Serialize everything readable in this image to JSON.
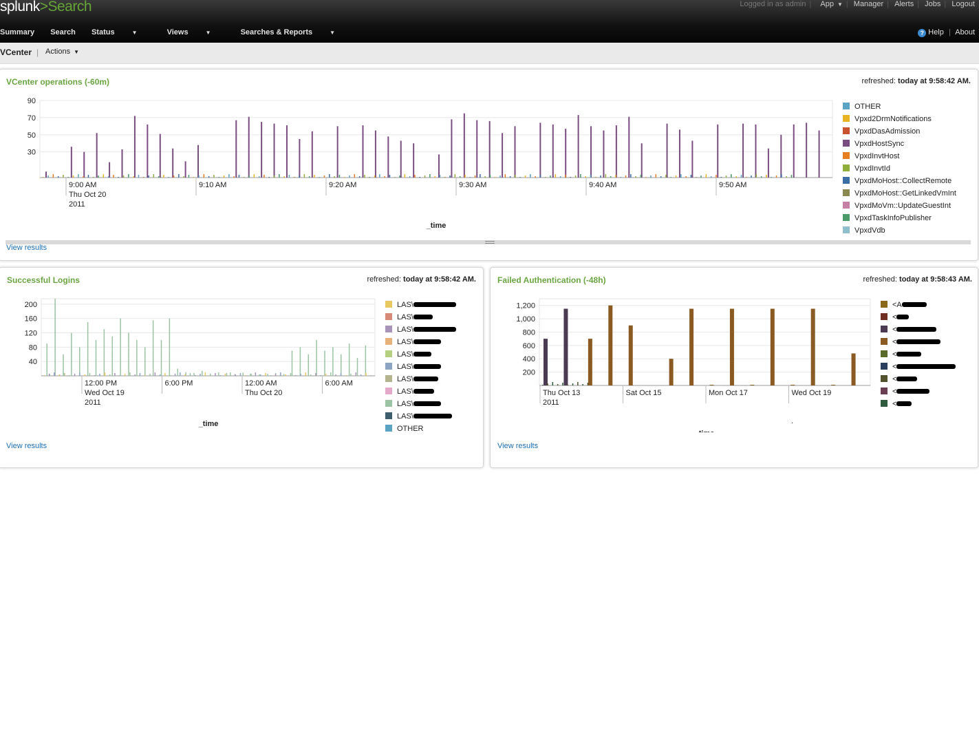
{
  "app": {
    "logo_text": "splunk",
    "logo_sep": ">",
    "logo_app": "Search",
    "top_links": {
      "logged_in": "Logged in as admin",
      "app": "App",
      "manager": "Manager",
      "alerts": "Alerts",
      "jobs": "Jobs",
      "logout": "Logout"
    },
    "nav": {
      "summary": "Summary",
      "search": "Search",
      "status": "Status",
      "views": "Views",
      "searches_reports": "Searches & Reports",
      "help": "Help",
      "about": "About"
    },
    "dashboard": {
      "title": "VCenter",
      "actions": "Actions"
    }
  },
  "panels": {
    "vcenter": {
      "title": "VCenter operations (-60m)",
      "refreshed_label": "refreshed:",
      "refreshed_value": "today at 9:58:42 AM.",
      "view_results": "View results",
      "x_title": "_time"
    },
    "logins": {
      "title": "Successful Logins",
      "refreshed_label": "refreshed:",
      "refreshed_value": "today at 9:58:42 AM.",
      "view_results": "View results",
      "x_title": "_time"
    },
    "failed": {
      "title": "Failed Authentication (-48h)",
      "refreshed_label": "refreshed:",
      "refreshed_value": "today at 9:58:43 AM.",
      "view_results": "View results",
      "x_title": "_time",
      "stray_mark": "."
    }
  },
  "chart_data": [
    {
      "type": "bar",
      "id": "vcenter",
      "title": "VCenter operations (-60m)",
      "xlabel": "_time",
      "ylabel": "",
      "ylim": [
        0,
        90
      ],
      "y_ticks": [
        "90",
        "70",
        "50",
        "30"
      ],
      "x_ticks": [
        {
          "lines": [
            "9:00 AM",
            "Thu Oct 20",
            "2011"
          ]
        },
        {
          "lines": [
            "9:10 AM"
          ]
        },
        {
          "lines": [
            "9:20 AM"
          ]
        },
        {
          "lines": [
            "9:30 AM"
          ]
        },
        {
          "lines": [
            "9:40 AM"
          ]
        },
        {
          "lines": [
            "9:50 AM"
          ]
        }
      ],
      "grid": true,
      "legend_position": "right",
      "colors": {
        "OTHER": "#5ba3c4",
        "Vpxd2DrmNotifications": "#e8b424",
        "VpxdDasAdmission": "#c8532e",
        "VpxdHostSync": "#7a4d80",
        "VpxdInvtHost": "#e67e22",
        "VpxdInvtId": "#8faf3a",
        "VpxdMoHost::CollectRemote": "#3a6ea5",
        "VpxdMoHost::GetLinkedVmInt": "#8a8a50",
        "VpxdMoVm::UpdateGuestInt": "#c77fa6",
        "VpxdTaskInfoPublisher": "#4a9a6a",
        "VpxdVdb": "#8fbfcc"
      },
      "series": [
        {
          "name": "OTHER",
          "values": [
            0,
            0,
            0,
            0,
            0,
            0,
            0,
            0,
            0,
            0,
            0,
            0,
            0,
            0,
            0,
            0,
            0,
            0,
            0,
            0,
            0,
            0,
            0,
            0,
            0,
            0,
            0,
            0,
            0,
            0,
            0,
            0,
            0,
            0,
            0,
            0,
            0,
            0,
            0,
            0,
            0,
            0,
            0,
            0,
            0,
            0,
            0,
            0,
            0,
            0,
            0,
            0,
            0,
            0,
            0,
            0,
            0,
            0,
            0,
            0,
            0,
            0
          ]
        },
        {
          "name": "VpxdHostSync",
          "values": [
            7,
            0,
            36,
            30,
            52,
            18,
            33,
            72,
            62,
            51,
            34,
            19,
            38,
            0,
            0,
            67,
            71,
            65,
            63,
            61,
            45,
            54,
            0,
            60,
            0,
            61,
            55,
            48,
            43,
            40,
            0,
            27,
            68,
            75,
            67,
            66,
            52,
            60,
            0,
            64,
            62,
            57,
            73,
            60,
            55,
            61,
            71,
            40,
            0,
            63,
            56,
            43,
            0,
            62,
            0,
            63,
            62,
            34,
            50,
            62,
            64,
            55
          ]
        },
        {
          "name": "VpxdTaskInfoPublisher",
          "values": [
            0,
            0,
            0,
            0,
            0,
            0,
            0,
            0,
            0,
            0,
            0,
            0,
            0,
            0,
            0,
            0,
            0,
            0,
            0,
            0,
            0,
            0,
            0,
            0,
            0,
            0,
            0,
            0,
            0,
            0,
            0,
            0,
            0,
            0,
            0,
            0,
            0,
            0,
            0,
            0,
            0,
            0,
            0,
            0,
            0,
            0,
            0,
            0,
            0,
            0,
            0,
            0,
            0,
            0,
            0,
            0,
            0,
            0,
            0,
            0,
            0,
            0
          ]
        }
      ]
    },
    {
      "type": "bar",
      "id": "logins",
      "title": "Successful Logins",
      "xlabel": "_time",
      "ylabel": "",
      "ylim": [
        0,
        215
      ],
      "y_ticks": [
        "200",
        "160",
        "120",
        "80",
        "40"
      ],
      "x_ticks": [
        {
          "lines": [
            "12:00 PM",
            "Wed Oct 19",
            "2011"
          ]
        },
        {
          "lines": [
            "6:00 PM"
          ]
        },
        {
          "lines": [
            "12:00 AM",
            "Thu Oct 20"
          ]
        },
        {
          "lines": [
            "6:00 AM"
          ]
        }
      ],
      "grid": true,
      "legend_position": "right",
      "legend": [
        "LAS\\",
        "LAS\\",
        "LAS\\",
        "LAS\\",
        "LAS\\",
        "LAS\\",
        "LAS\\",
        "LAS\\",
        "LAS\\",
        "LAS\\",
        "OTHER"
      ],
      "series": [
        {
          "name": "OTHER",
          "values": [
            0,
            0,
            0,
            0,
            0,
            0,
            0,
            0,
            0,
            0,
            0,
            0,
            0,
            0,
            0,
            0,
            0,
            0,
            0,
            0,
            0,
            0,
            0,
            0,
            0,
            0,
            0,
            0,
            0,
            0,
            0,
            0,
            0,
            0,
            0,
            0,
            0,
            0,
            0,
            0
          ]
        },
        {
          "name": "LAS\\",
          "values": [
            90,
            215,
            60,
            120,
            80,
            150,
            100,
            130,
            110,
            160,
            120,
            100,
            80,
            155,
            100,
            160,
            20,
            10,
            8,
            14,
            6,
            10,
            8,
            5,
            9,
            6,
            4,
            6,
            8,
            5,
            70,
            80,
            60,
            100,
            70,
            80,
            60,
            90,
            50,
            85
          ]
        }
      ]
    },
    {
      "type": "bar",
      "id": "failed",
      "title": "Failed Authentication (-48h)",
      "xlabel": "_time",
      "ylabel": "",
      "ylim": [
        0,
        1300
      ],
      "y_ticks": [
        "1,200",
        "1,000",
        "800",
        "600",
        "400",
        "200"
      ],
      "x_ticks": [
        {
          "lines": [
            "Thu Oct 13",
            "2011"
          ]
        },
        {
          "lines": [
            "Sat Oct 15"
          ]
        },
        {
          "lines": [
            "Mon Oct 17"
          ]
        },
        {
          "lines": [
            "Wed Oct 19"
          ]
        }
      ],
      "grid": true,
      "legend_position": "right",
      "legend": [
        "<A",
        "<",
        "<",
        "<",
        "<",
        "<",
        "<",
        "<",
        "<"
      ],
      "series": [
        {
          "name": "<A",
          "values": [
            700,
            1150,
            0,
            0,
            0,
            0,
            0,
            0,
            0,
            0,
            0,
            0,
            0,
            0,
            0,
            0
          ]
        },
        {
          "name": "<",
          "values": [
            0,
            0,
            700,
            1200,
            900,
            0,
            400,
            1150,
            10,
            1150,
            10,
            1150,
            10,
            1150,
            10,
            480
          ]
        }
      ]
    }
  ]
}
